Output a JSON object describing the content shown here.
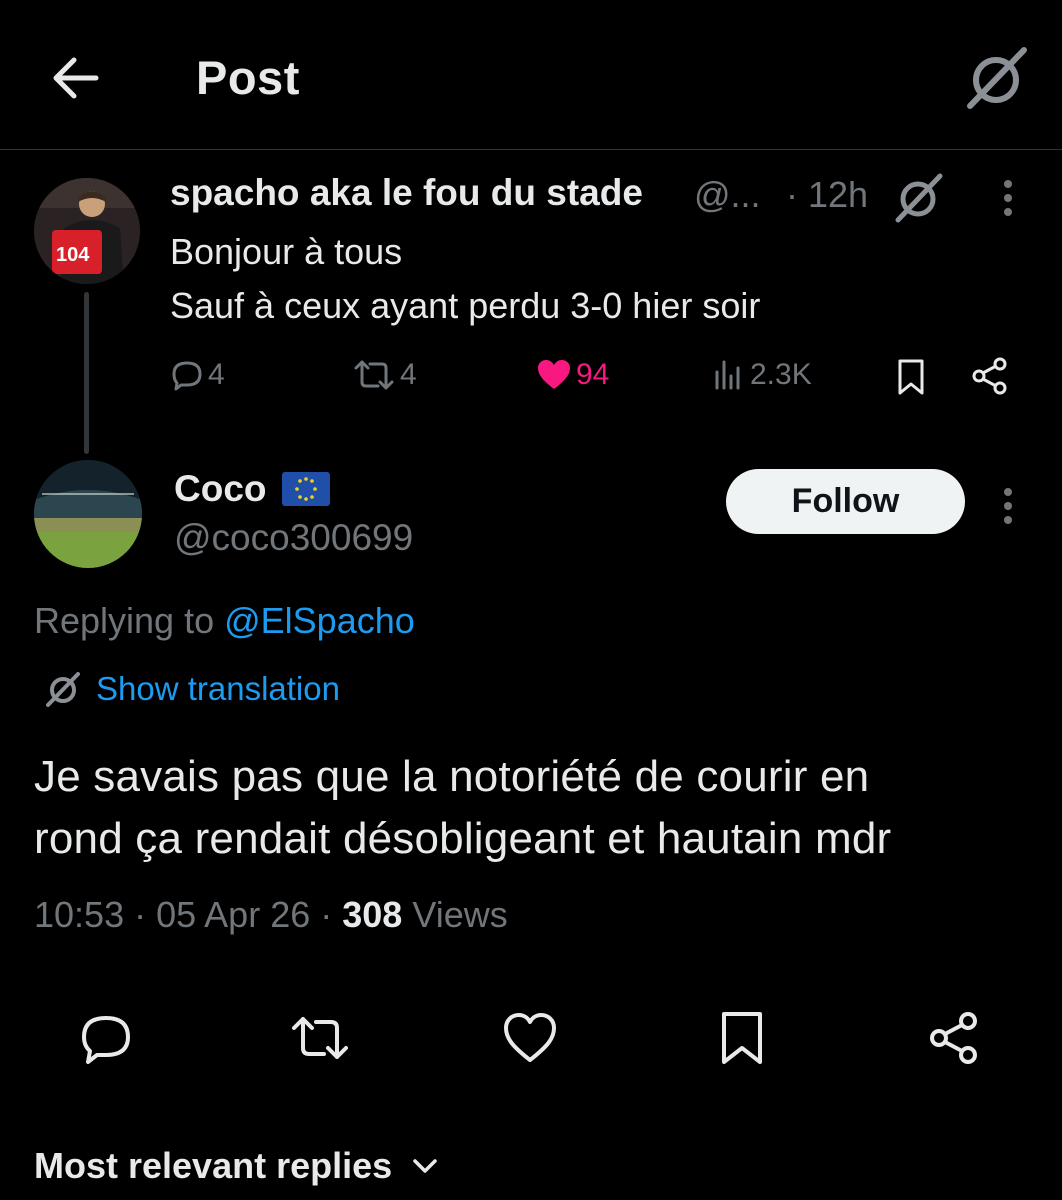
{
  "header": {
    "title": "Post",
    "back_icon": "arrow-left-icon",
    "grok_icon": "grok-icon"
  },
  "parent_post": {
    "author_name": "spacho aka le fou du stade",
    "author_handle": "@...",
    "time": "· 12h",
    "line1": "Bonjour à tous",
    "line2": "Sauf à ceux ayant perdu 3-0 hier soir",
    "reply_count": "4",
    "repost_count": "4",
    "like_count": "94",
    "view_count": "2.3K",
    "avatar_jersey": "104",
    "like_color": "#f91880"
  },
  "reply": {
    "author_name": "Coco",
    "author_handle": "@coco300699",
    "follow_label": "Follow",
    "replying_prefix": "Replying to ",
    "replying_to": "@ElSpacho",
    "show_translation": "Show translation",
    "text_line1": "Je savais pas que la notoriété de courir en",
    "text_line2": "rond ça rendait désobligeant et hautain mdr",
    "time": "10:53",
    "date": "05 Apr 26",
    "views_count": "308",
    "views_label": "Views"
  },
  "section": {
    "most_relevant": "Most relevant replies"
  },
  "colors": {
    "background": "#000000",
    "text": "#e7e9ea",
    "muted": "#71767b",
    "link": "#1d9bf0",
    "like": "#f91880",
    "follow_bg": "#eff3f4"
  }
}
